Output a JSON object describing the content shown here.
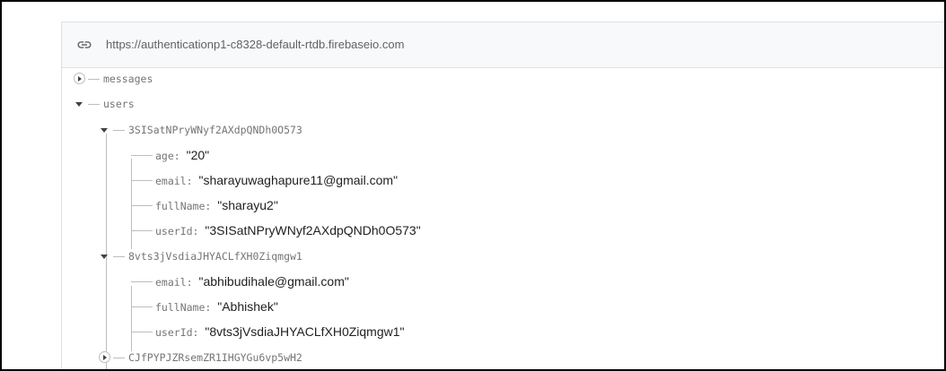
{
  "url": "https://authenticationp1-c8328-default-rtdb.firebaseio.com",
  "icons": {
    "link": "link-icon",
    "expand": "expand-icon",
    "collapse": "collapse-icon"
  },
  "tree": {
    "messages": "messages",
    "users": "users",
    "user1": {
      "key": "3SISatNPryWNyf2AXdpQNDh0O573",
      "fields": [
        {
          "key": "age",
          "value": "\"20\""
        },
        {
          "key": "email",
          "value": "\"sharayuwaghapure11@gmail.com\""
        },
        {
          "key": "fullName",
          "value": "\"sharayu2\""
        },
        {
          "key": "userId",
          "value": "\"3SISatNPryWNyf2AXdpQNDh0O573\""
        }
      ]
    },
    "user2": {
      "key": "8vts3jVsdiaJHYACLfXH0Ziqmgw1",
      "fields": [
        {
          "key": "email",
          "value": "\"abhibudihale@gmail.com\""
        },
        {
          "key": "fullName",
          "value": "\"Abhishek\""
        },
        {
          "key": "userId",
          "value": "\"8vts3jVsdiaJHYACLfXH0Ziqmgw1\""
        }
      ]
    },
    "user3": {
      "key": "CJfPYPJZRsemZR1IHGYGu6vp5wH2"
    }
  }
}
